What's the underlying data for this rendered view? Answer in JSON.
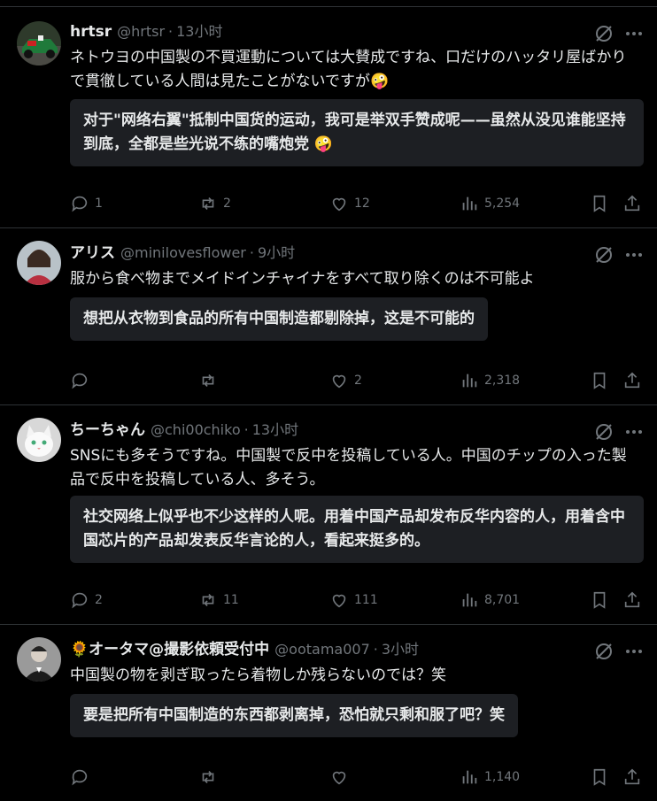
{
  "colors": {
    "bg": "#000000",
    "text": "#e7e9ea",
    "muted": "#71767b",
    "divider": "#2f3336",
    "translation_bg": "#1d1f23"
  },
  "posts": [
    {
      "name": "hrtsr",
      "handle": "@hrtsr",
      "time": "13小时",
      "text": "ネトウヨの中国製の不買運動については大賛成ですね、口だけのハッタリ屋ばかりで貫徹している人間は見たことがないですが🤪",
      "translation": "对于\"网络右翼\"抵制中国货的运动，我可是举双手赞成呢——虽然从没见谁能坚持到底，全都是些光说不练的嘴炮党 🤪",
      "replies": "1",
      "reposts": "2",
      "likes": "12",
      "views": "5,254"
    },
    {
      "name": "アリス",
      "handle": "@minilovesflower",
      "time": "9小时",
      "text": "服から食べ物までメイドインチャイナをすべて取り除くのは不可能よ",
      "translation": "想把从衣物到食品的所有中国制造都剔除掉，这是不可能的",
      "replies": "",
      "reposts": "",
      "likes": "2",
      "views": "2,318"
    },
    {
      "name": "ちーちゃん",
      "handle": "@chi00chiko",
      "time": "13小时",
      "text": "SNSにも多そうですね。中国製で反中を投稿している人。中国のチップの入った製品で反中を投稿している人、多そう。",
      "translation": "社交网络上似乎也不少这样的人呢。用着中国产品却发布反华内容的人，用着含中国芯片的产品却发表反华言论的人，看起来挺多的。",
      "replies": "2",
      "reposts": "11",
      "likes": "111",
      "views": "8,701"
    },
    {
      "name": "🌻オータマ@撮影依頼受付中",
      "handle": "@ootama007",
      "time": "3小时",
      "text": "中国製の物を剥ぎ取ったら着物しか残らないのでは？笑",
      "translation": "要是把所有中国制造的东西都剥离掉，恐怕就只剩和服了吧？笑",
      "replies": "",
      "reposts": "",
      "likes": "",
      "views": "1,140"
    }
  ],
  "icons": [
    "grok-icon",
    "more-icon",
    "reply-icon",
    "repost-icon",
    "like-icon",
    "views-icon",
    "bookmark-icon",
    "share-icon"
  ]
}
